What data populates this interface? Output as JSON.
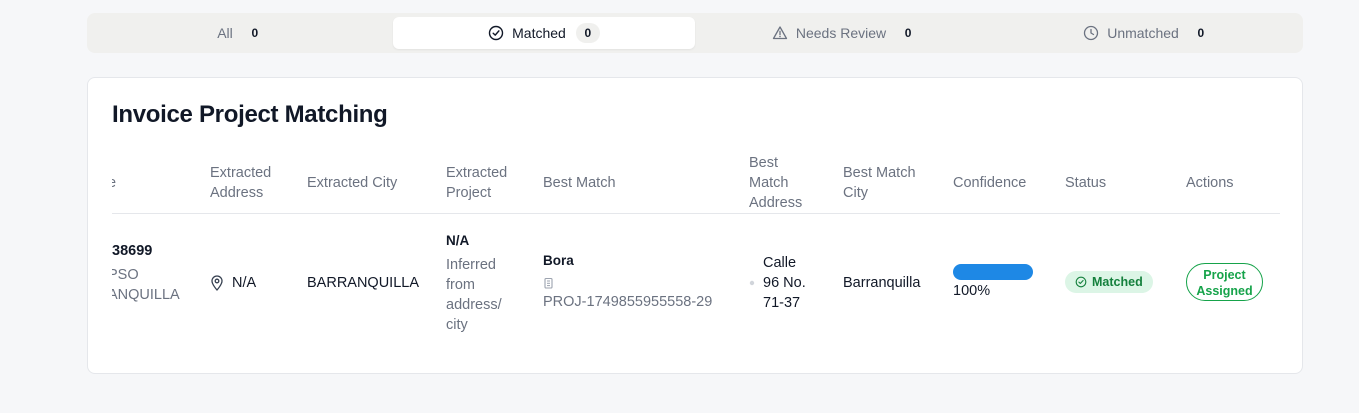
{
  "tabs": [
    {
      "label": "All",
      "count": "0",
      "icon": "none"
    },
    {
      "label": "Matched",
      "count": "0",
      "icon": "check-circle-icon"
    },
    {
      "label": "Needs Review",
      "count": "0",
      "icon": "warning-triangle-icon"
    },
    {
      "label": "Unmatched",
      "count": "0",
      "icon": "clock-icon"
    }
  ],
  "active_tab": "Matched",
  "card": {
    "title": "Invoice Project Matching"
  },
  "columns": {
    "first_fragment": "e",
    "extracted_address": [
      "Extracted",
      "Address"
    ],
    "extracted_city": "Extracted City",
    "extracted_project": [
      "Extracted",
      "Project"
    ],
    "best_match": "Best Match",
    "best_match_address": [
      "Best",
      "Match",
      "Address"
    ],
    "best_match_city": [
      "Best Match",
      "City"
    ],
    "confidence": "Confidence",
    "status": "Status",
    "actions": "Actions"
  },
  "row": {
    "invoice_number": "38699",
    "vendor_line1": "PSO",
    "vendor_line2": "ANQUILLA",
    "extracted_address": "N/A",
    "extracted_city": "BARRANQUILLA",
    "extracted_project": "N/A",
    "extracted_project_note": [
      "Inferred",
      "from",
      "address/",
      "city"
    ],
    "best_match_name": "Bora",
    "best_match_id": "PROJ-1749855955558-29",
    "best_match_address": [
      "Calle",
      "96 No.",
      "71-37"
    ],
    "best_match_city": "Barranquilla",
    "confidence_value": 1.0,
    "confidence_label": "100%",
    "status": "Matched",
    "action_label": [
      "Project",
      "Assigned"
    ]
  },
  "colors": {
    "accent_blue": "#1e88e5",
    "success_green": "#16a34a",
    "success_bg": "#dcf5e6"
  }
}
